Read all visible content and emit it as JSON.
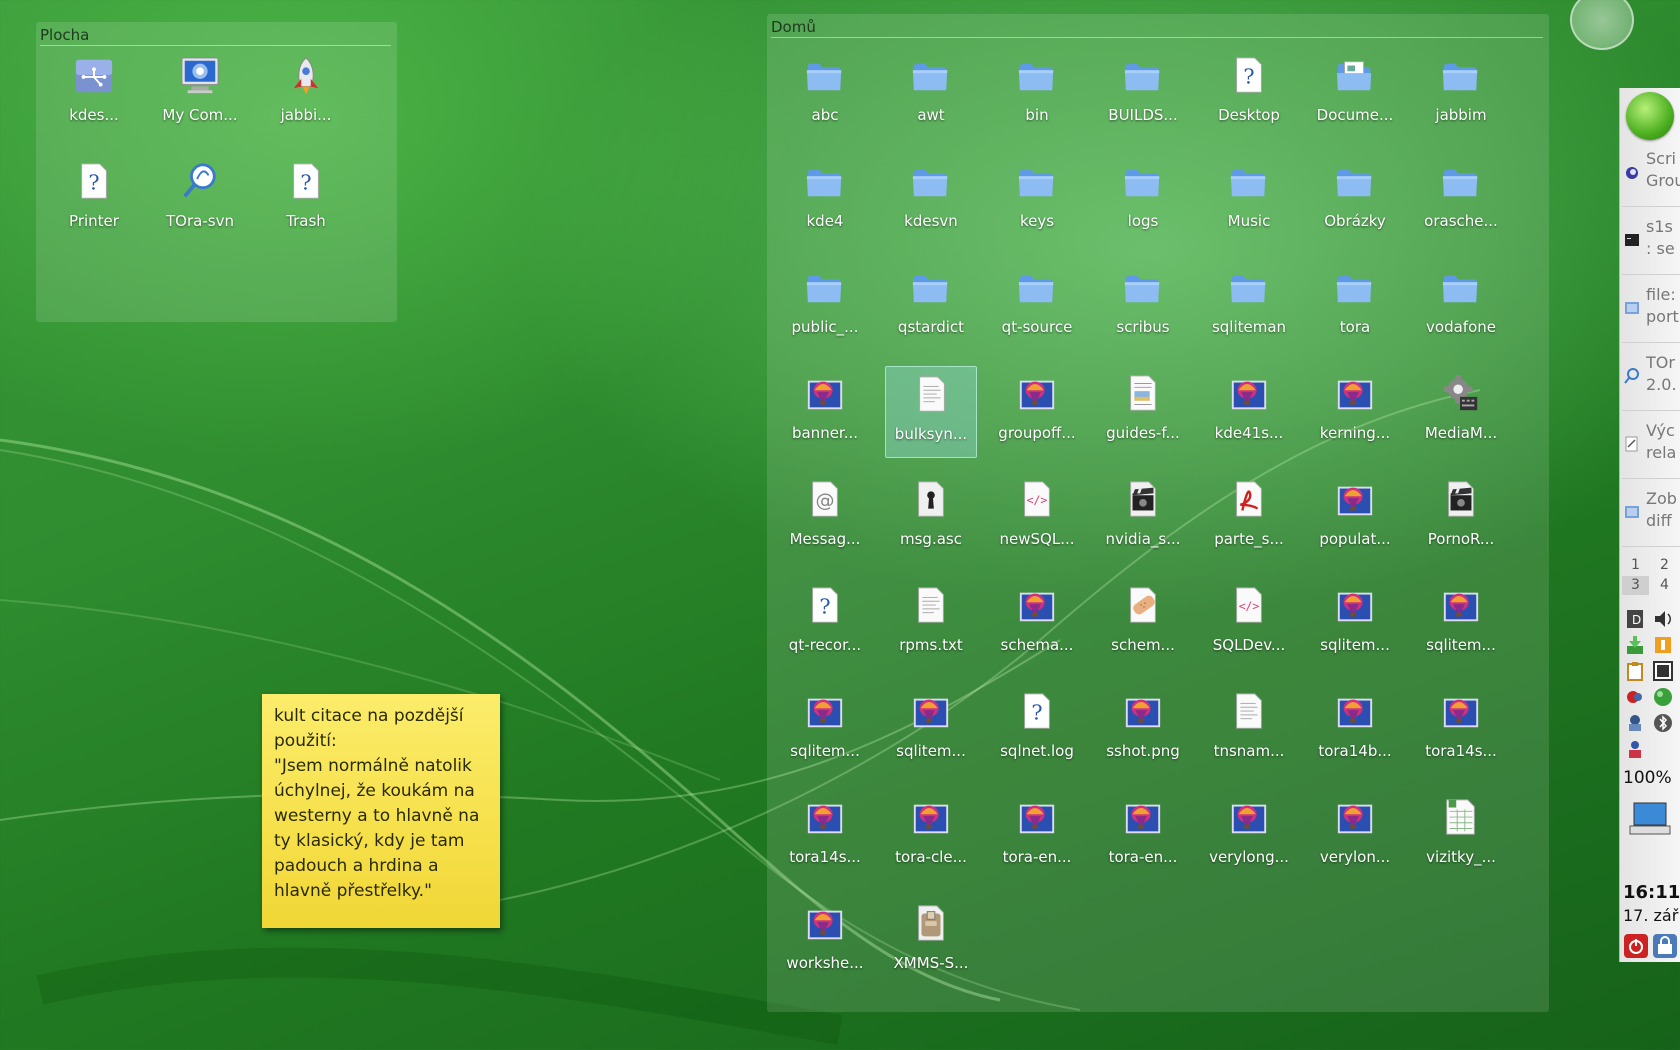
{
  "desktop": {
    "plocha": {
      "title": "Plocha",
      "items": [
        {
          "label": "kdes...",
          "icon": "network-icon"
        },
        {
          "label": "My Com...",
          "icon": "computer-icon"
        },
        {
          "label": "jabbi...",
          "icon": "rocket-icon"
        },
        {
          "label": "Printer",
          "icon": "unknown-file-icon"
        },
        {
          "label": "TOra-svn",
          "icon": "tora-icon"
        },
        {
          "label": "Trash",
          "icon": "unknown-file-icon"
        }
      ]
    },
    "domu": {
      "title": "Domů",
      "items": [
        {
          "label": "abc",
          "icon": "folder-icon"
        },
        {
          "label": "awt",
          "icon": "folder-icon"
        },
        {
          "label": "bin",
          "icon": "folder-icon"
        },
        {
          "label": "BUILDS...",
          "icon": "folder-icon"
        },
        {
          "label": "Desktop",
          "icon": "unknown-file-icon"
        },
        {
          "label": "Docume...",
          "icon": "documents-folder-icon"
        },
        {
          "label": "jabbim",
          "icon": "folder-icon"
        },
        {
          "label": "kde4",
          "icon": "folder-icon"
        },
        {
          "label": "kdesvn",
          "icon": "folder-icon"
        },
        {
          "label": "keys",
          "icon": "folder-icon"
        },
        {
          "label": "logs",
          "icon": "folder-icon"
        },
        {
          "label": "Music",
          "icon": "folder-icon"
        },
        {
          "label": "Obrázky",
          "icon": "folder-icon"
        },
        {
          "label": "orasche...",
          "icon": "folder-icon"
        },
        {
          "label": "public_...",
          "icon": "folder-icon"
        },
        {
          "label": "qstardict",
          "icon": "folder-icon"
        },
        {
          "label": "qt-source",
          "icon": "folder-icon"
        },
        {
          "label": "scribus",
          "icon": "folder-icon"
        },
        {
          "label": "sqliteman",
          "icon": "folder-icon"
        },
        {
          "label": "tora",
          "icon": "folder-icon"
        },
        {
          "label": "vodafone",
          "icon": "folder-icon"
        },
        {
          "label": "banner...",
          "icon": "image-icon"
        },
        {
          "label": "bulksyn...",
          "icon": "text-file-icon",
          "selected": true
        },
        {
          "label": "groupoff...",
          "icon": "image-icon"
        },
        {
          "label": "guides-f...",
          "icon": "document-icon"
        },
        {
          "label": "kde41s...",
          "icon": "image-icon"
        },
        {
          "label": "kerning...",
          "icon": "image-icon"
        },
        {
          "label": "MediaM...",
          "icon": "gear-icon"
        },
        {
          "label": "Messag...",
          "icon": "mail-icon"
        },
        {
          "label": "msg.asc",
          "icon": "keyhole-icon"
        },
        {
          "label": "newSQL...",
          "icon": "html-icon"
        },
        {
          "label": "nvidia_s...",
          "icon": "video-icon"
        },
        {
          "label": "parte_s...",
          "icon": "pdf-icon"
        },
        {
          "label": "populat...",
          "icon": "image-icon"
        },
        {
          "label": "PornoR...",
          "icon": "video-icon"
        },
        {
          "label": "qt-recor...",
          "icon": "unknown-file-icon"
        },
        {
          "label": "rpms.txt",
          "icon": "text-file-icon"
        },
        {
          "label": "schema...",
          "icon": "image-icon"
        },
        {
          "label": "schem...",
          "icon": "patch-icon"
        },
        {
          "label": "SQLDev...",
          "icon": "html-icon"
        },
        {
          "label": "sqlitem...",
          "icon": "image-icon"
        },
        {
          "label": "sqlitem...",
          "icon": "image-icon"
        },
        {
          "label": "sqlitem...",
          "icon": "image-icon"
        },
        {
          "label": "sqlitem...",
          "icon": "image-icon"
        },
        {
          "label": "sqlnet.log",
          "icon": "unknown-file-icon"
        },
        {
          "label": "sshot.png",
          "icon": "image-icon"
        },
        {
          "label": "tnsnam...",
          "icon": "text-file-icon"
        },
        {
          "label": "tora14b...",
          "icon": "image-icon"
        },
        {
          "label": "tora14s...",
          "icon": "image-icon"
        },
        {
          "label": "tora14s...",
          "icon": "image-icon"
        },
        {
          "label": "tora-cle...",
          "icon": "image-icon"
        },
        {
          "label": "tora-en...",
          "icon": "image-icon"
        },
        {
          "label": "tora-en...",
          "icon": "image-icon"
        },
        {
          "label": "verylong...",
          "icon": "image-icon"
        },
        {
          "label": "verylon...",
          "icon": "image-icon"
        },
        {
          "label": "vizitky_...",
          "icon": "spreadsheet-icon"
        },
        {
          "label": "workshe...",
          "icon": "image-icon"
        },
        {
          "label": "XMMS-S...",
          "icon": "archive-icon"
        }
      ]
    },
    "note": {
      "lines": [
        "kult citace na pozdější",
        "použití:",
        "\"Jsem normálně natolik",
        "úchylnej, že koukám na",
        "westerny a to hlavně na",
        "ty klasický, kdy je tam",
        "padouch a hrdina a",
        "hlavně přestřelky.\""
      ]
    }
  },
  "panel": {
    "tasks": [
      {
        "text1": "Scri",
        "text2": "Grou",
        "icon": "scribus-icon"
      },
      {
        "text1": "s1s",
        "text2": ": se",
        "icon": "terminal-icon"
      },
      {
        "text1": "file:",
        "text2": "port",
        "icon": "file-manager-icon"
      },
      {
        "text1": "TOr",
        "text2": "2.0.",
        "icon": "tora-icon"
      },
      {
        "text1": "Výc",
        "text2": "rela",
        "icon": "editor-icon"
      },
      {
        "text1": "Zob",
        "text2": "diff",
        "icon": "file-manager-icon"
      }
    ],
    "pager": [
      "1",
      "2",
      "3",
      "4"
    ],
    "battery": "100%",
    "clock_time": "16:11",
    "clock_date": "17. zář"
  }
}
